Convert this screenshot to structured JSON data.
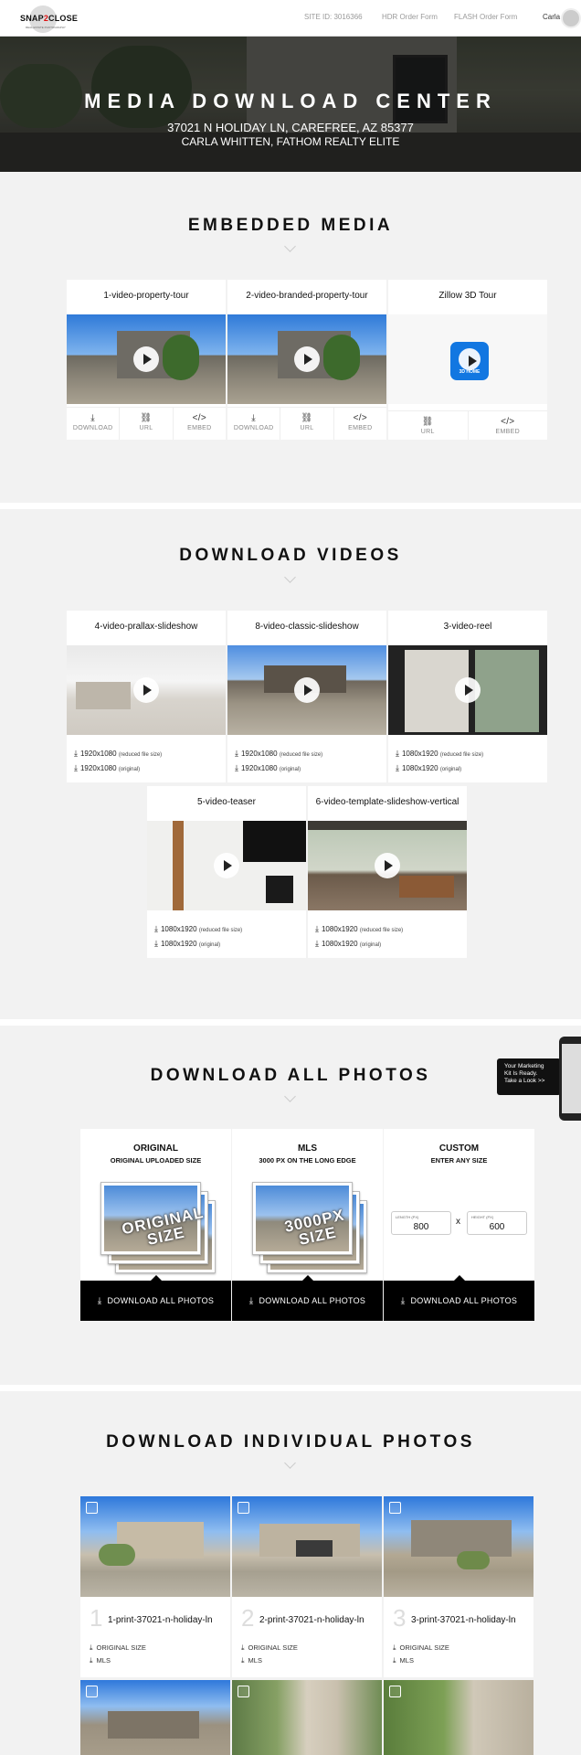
{
  "brand": {
    "logo_text_a": "SNAP",
    "logo_text_b": "2",
    "logo_text_c": "CLOSE",
    "tagline": "REAL ESTATE PHOTOGRAPHY"
  },
  "nav": {
    "site_id": "SITE ID: 3016366",
    "hdr": "HDR Order Form",
    "flash": "FLASH Order Form",
    "user": "Carla"
  },
  "hero": {
    "title": "MEDIA DOWNLOAD CENTER",
    "address": "37021 N HOLIDAY LN, CAREFREE, AZ 85377",
    "agent": "CARLA WHITTEN, FATHOM REALTY ELITE"
  },
  "embedded": {
    "title": "EMBEDDED MEDIA",
    "cards": [
      {
        "title": "1-video-property-tour",
        "actions": [
          "DOWNLOAD",
          "URL",
          "EMBED"
        ]
      },
      {
        "title": "2-video-branded-property-tour",
        "actions": [
          "DOWNLOAD",
          "URL",
          "EMBED"
        ]
      },
      {
        "title": "Zillow 3D Tour",
        "badge": "3D HOME",
        "actions": [
          "URL",
          "EMBED"
        ]
      }
    ]
  },
  "videos": {
    "title": "DOWNLOAD VIDEOS",
    "cards": [
      {
        "title": "4-video-prallax-slideshow",
        "r1": "1920x1080",
        "r2": "1920x1080"
      },
      {
        "title": "8-video-classic-slideshow",
        "r1": "1920x1080",
        "r2": "1920x1080"
      },
      {
        "title": "3-video-reel",
        "r1": "1080x1920",
        "r2": "1080x1920"
      },
      {
        "title": "5-video-teaser",
        "r1": "1080x1920",
        "r2": "1080x1920"
      },
      {
        "title": "6-video-template-slideshow-vertical",
        "r1": "1080x1920",
        "r2": "1080x1920"
      }
    ],
    "reduced_note": "(reduced file size)",
    "original_note": "(original)"
  },
  "all_photos": {
    "title": "DOWNLOAD ALL PHOTOS",
    "original": {
      "heading": "ORIGINAL",
      "sub": "ORIGINAL UPLOADED SIZE",
      "stamp_a": "ORIGINAL",
      "stamp_b": "SIZE"
    },
    "mls": {
      "heading": "MLS",
      "sub": "3000 PX ON THE LONG EDGE",
      "stamp_a": "3000PX",
      "stamp_b": "SIZE"
    },
    "custom": {
      "heading": "CUSTOM",
      "sub": "ENTER ANY SIZE",
      "length_label": "LENGTH (PX)",
      "length_value": "800",
      "height_label": "HEIGHT (PX)",
      "height_value": "600",
      "times": "x"
    },
    "button": "DOWNLOAD ALL PHOTOS"
  },
  "popup": {
    "line1": "Your Marketing",
    "line2": "Kit Is Ready.",
    "line3": "Take a Look >>"
  },
  "individual": {
    "title": "DOWNLOAD INDIVIDUAL PHOTOS",
    "items": [
      {
        "num": "1",
        "name": "1-print-37021-n-holiday-ln",
        "a": "ORIGINAL SIZE",
        "b": "MLS"
      },
      {
        "num": "2",
        "name": "2-print-37021-n-holiday-ln",
        "a": "ORIGINAL SIZE",
        "b": "MLS"
      },
      {
        "num": "3",
        "name": "3-print-37021-n-holiday-ln",
        "a": "ORIGINAL SIZE",
        "b": "MLS"
      }
    ]
  }
}
